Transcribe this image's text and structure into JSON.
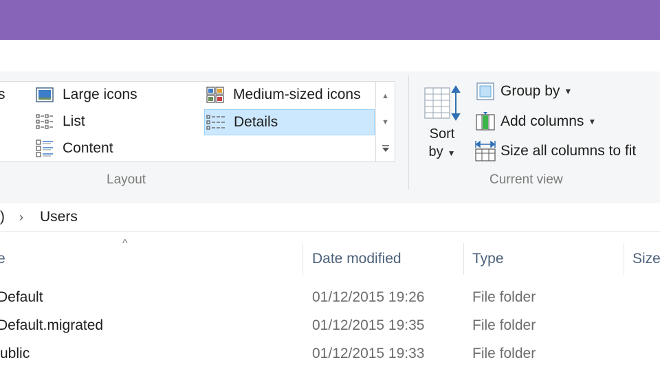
{
  "ribbon": {
    "layout": {
      "items": {
        "extra_large_icons": "s",
        "large_icons": "Large icons",
        "medium_icons": "Medium-sized icons",
        "list": "List",
        "details": "Details",
        "content": "Content"
      },
      "label": "Layout"
    },
    "current_view": {
      "sort_by_line1": "Sort",
      "sort_by_line2": "by",
      "group_by": "Group by",
      "add_columns": "Add columns",
      "size_all_columns": "Size all columns to fit",
      "label": "Current view"
    }
  },
  "address": {
    "prev_segment": ":)",
    "current": "Users"
  },
  "columns": {
    "name": "e",
    "date_modified": "Date modified",
    "type": "Type",
    "size": "Size"
  },
  "files": [
    {
      "name": "Default",
      "date": "01/12/2015 19:26",
      "type": "File folder"
    },
    {
      "name": "Default.migrated",
      "date": "01/12/2015 19:35",
      "type": "File folder"
    },
    {
      "name": "ublic",
      "date": "01/12/2015 19:33",
      "type": "File folder"
    }
  ],
  "colors": {
    "titlebar": "#8764b8",
    "selection": "#cce8ff",
    "header_text": "#4c607a"
  }
}
